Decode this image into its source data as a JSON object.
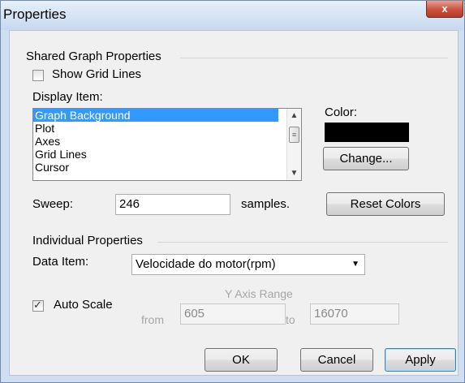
{
  "window": {
    "title": "Properties",
    "close_label": "x"
  },
  "shared": {
    "group_title": "Shared Graph Properties",
    "show_grid_lines": {
      "label": "Show Grid Lines",
      "checked": false
    },
    "display_item_label": "Display Item:",
    "display_items": [
      "Graph Background",
      "Plot",
      "Axes",
      "Grid Lines",
      "Cursor"
    ],
    "selected_display_item": "Graph Background",
    "color_label": "Color:",
    "color_value": "#000000",
    "change_button": "Change...",
    "sweep_label": "Sweep:",
    "sweep_value": "246",
    "sweep_unit": "samples.",
    "reset_colors_button": "Reset Colors"
  },
  "individual": {
    "group_title": "Individual Properties",
    "data_item_label": "Data Item:",
    "data_item_value": "Velocidade do motor(rpm)",
    "auto_scale": {
      "label": "Auto Scale",
      "checked": true
    },
    "y_axis_range_label": "Y Axis Range",
    "from_label": "from",
    "from_value": "605",
    "to_label": "to",
    "to_value": "16070"
  },
  "buttons": {
    "ok": "OK",
    "cancel": "Cancel",
    "apply": "Apply"
  }
}
